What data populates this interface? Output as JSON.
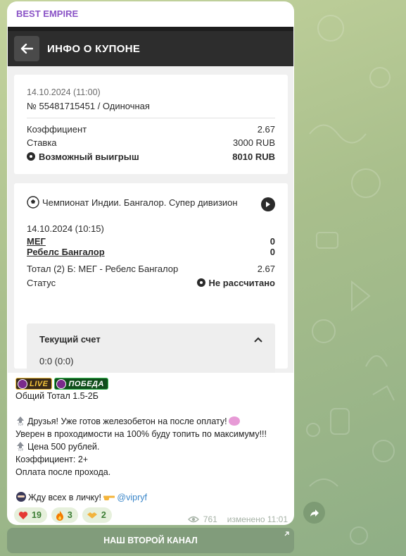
{
  "message": {
    "channel_name": "BEST EMPIRE",
    "coupon": {
      "header_title": "ИНФО О КУПОНЕ",
      "date": "14.10.2024 (11:00)",
      "number": "№ 55481715451 / Одиночная",
      "coef_label": "Коэффициент",
      "coef_value": "2.67",
      "stake_label": "Ставка",
      "stake_value": "3000 RUB",
      "win_label": "Возможный выигрыш",
      "win_value": "8010 RUB"
    },
    "event": {
      "league": "Чемпионат Индии. Бангалор. Супер дивизион",
      "datetime": "14.10.2024 (10:15)",
      "team1": "МЕГ",
      "score1": "0",
      "team2": "Ребелс Бангалор",
      "score2": "0",
      "bet_label": "Тотал (2) Б: МЕГ - Ребелс Бангалор",
      "bet_coef": "2.67",
      "status_label": "Статус",
      "status_value": "Не рассчитано",
      "score_title": "Текущий счет",
      "score_value": "0:0 (0:0)"
    },
    "badges": {
      "live": "LIVE",
      "win": "ПОБЕДА"
    },
    "text": {
      "line1": "Общий Тотал 1.5-2Б",
      "line2": "Друзья! Уже готов железобетон на после оплату!",
      "line3": "Уверен в проходимости на 100% буду топить по максимуму!!!",
      "line4": "Цена 500 рублей.",
      "line5": "Коэффициент: 2+",
      "line6": "Оплата после прохода.",
      "line7": "Жду всех в личку! ",
      "mention": "@vipryf"
    },
    "reactions": [
      {
        "emoji": "heart",
        "count": "19"
      },
      {
        "emoji": "fire",
        "count": "3"
      },
      {
        "emoji": "handshake",
        "count": "2"
      }
    ],
    "views": "761",
    "edited": "изменено 11:01"
  },
  "channel_button": "НАШ ВТОРОЙ КАНАЛ"
}
